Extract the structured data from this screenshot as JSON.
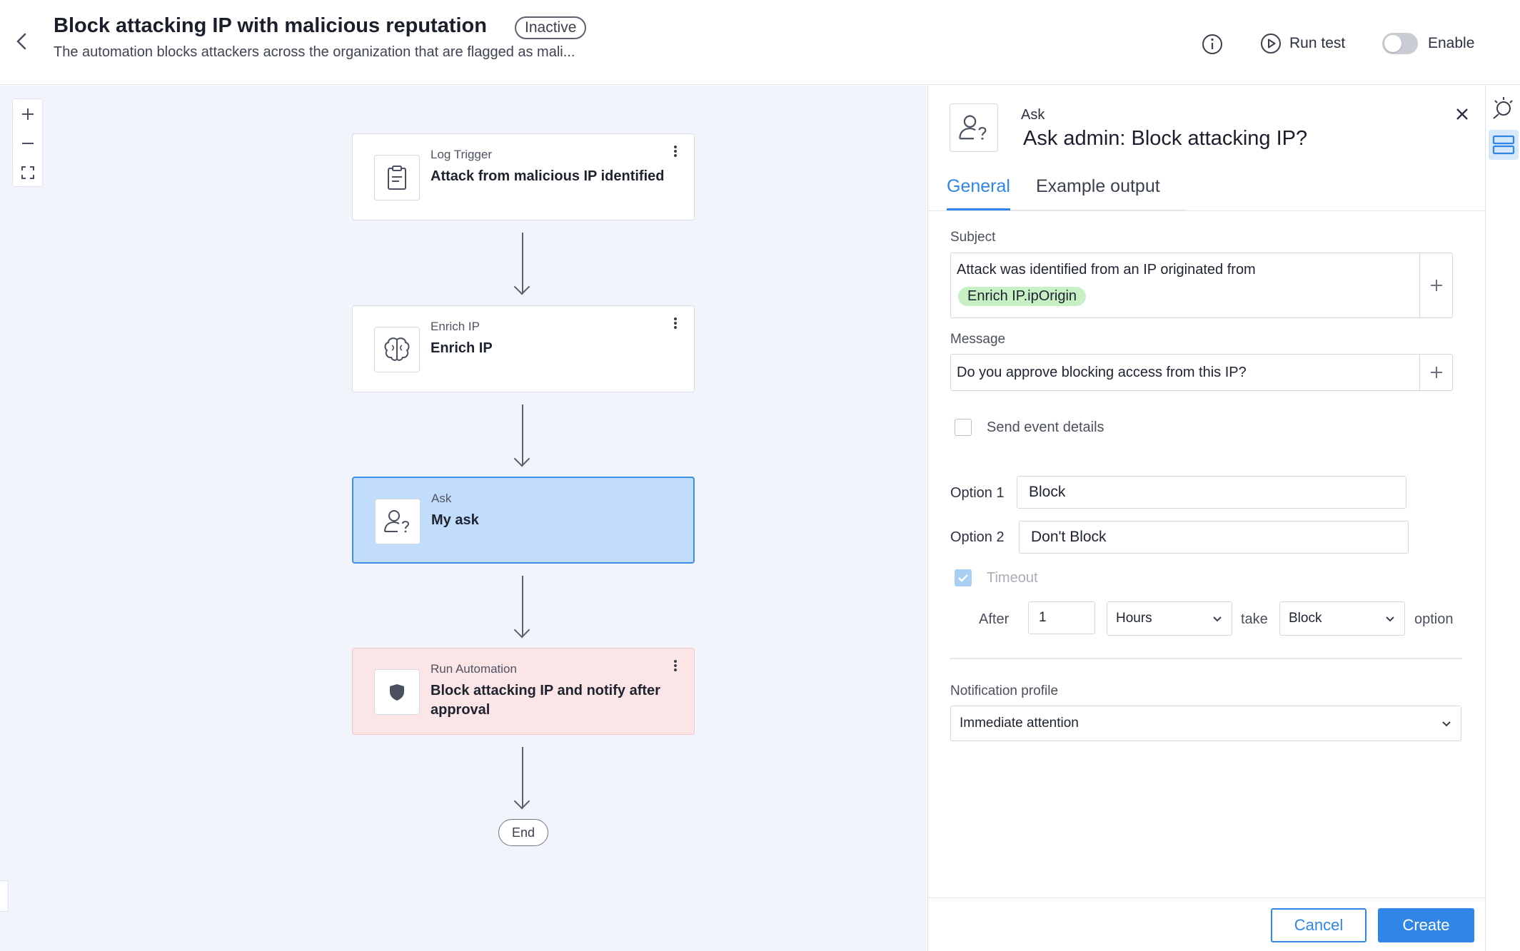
{
  "header": {
    "title": "Block attacking IP with malicious reputation",
    "status": "Inactive",
    "subtitle": "The automation blocks attackers across the organization that are flagged as mali...",
    "run_test_label": "Run test",
    "enable_label": "Enable"
  },
  "flow": {
    "nodes": [
      {
        "type": "Log Trigger",
        "name": "Attack from malicious IP identified",
        "icon": "clipboard-icon"
      },
      {
        "type": "Enrich IP",
        "name": "Enrich IP",
        "icon": "brain-icon"
      },
      {
        "type": "Ask",
        "name": "My ask",
        "icon": "user-question-icon"
      },
      {
        "type": "Run Automation",
        "name": "Block attacking IP and notify after approval",
        "icon": "shield-icon"
      }
    ],
    "end_label": "End"
  },
  "panel": {
    "type": "Ask",
    "title": "Ask admin: Block attacking IP?",
    "tabs": [
      "General",
      "Example output"
    ],
    "active_tab": "General",
    "subject_label": "Subject",
    "subject_text": "Attack was identified from an IP originated from",
    "subject_chip": "Enrich IP.ipOrigin",
    "message_label": "Message",
    "message_text": "Do you approve blocking access from this IP?",
    "send_event_details_label": "Send event details",
    "option1_label": "Option 1",
    "option1_value": "Block",
    "option2_label": "Option 2",
    "option2_value": "Don't Block",
    "timeout_label": "Timeout",
    "after_label": "After",
    "after_value": "1",
    "unit_value": "Hours",
    "take_label": "take",
    "take_value": "Block",
    "option_label": "option",
    "notification_label": "Notification profile",
    "notification_value": "Immediate attention",
    "cancel_label": "Cancel",
    "create_label": "Create"
  },
  "colors": {
    "accent": "#2f86e6",
    "selected_node": "#c2dcfb",
    "danger_node": "#fbe5e6",
    "chip": "#c7f0c4"
  }
}
